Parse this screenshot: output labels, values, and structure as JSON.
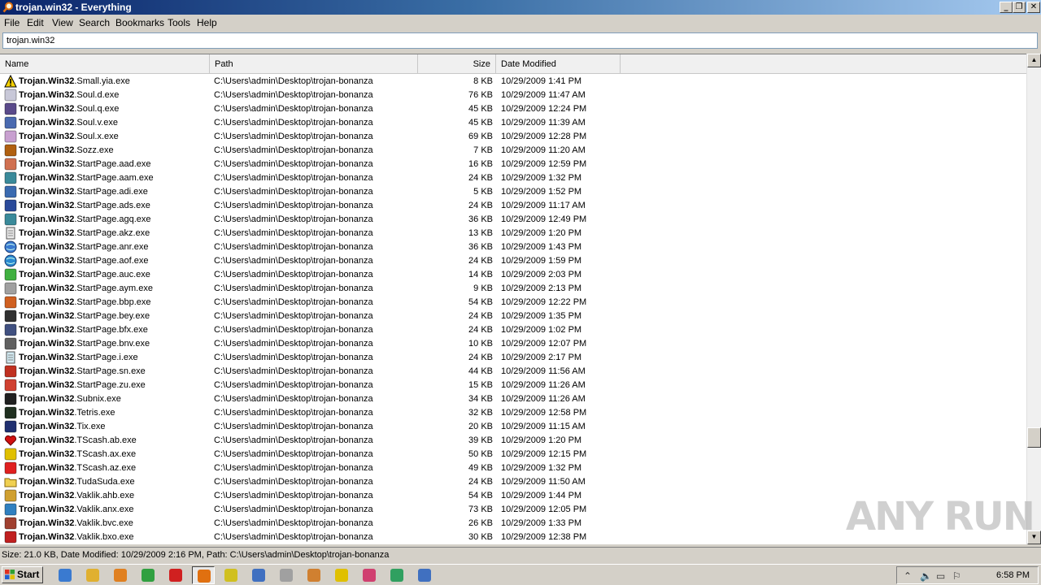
{
  "window": {
    "title": "trojan.win32 - Everything",
    "controls": {
      "minimize": "_",
      "restore": "❐",
      "close": "✕"
    }
  },
  "menu": [
    "File",
    "Edit",
    "View",
    "Search",
    "Bookmarks",
    "Tools",
    "Help"
  ],
  "search": {
    "value": "trojan.win32"
  },
  "columns": {
    "name": "Name",
    "path": "Path",
    "size": "Size",
    "date": "Date Modified"
  },
  "rows": [
    {
      "bold": "Trojan.Win32",
      "rest": ".Small.yia.exe",
      "path": "C:\\Users\\admin\\Desktop\\trojan-bonanza",
      "size": "8 KB",
      "date": "10/29/2009 1:41 PM",
      "icon": "warning-icon",
      "color": "#f4d000"
    },
    {
      "bold": "Trojan.Win32",
      "rest": ".Soul.d.exe",
      "path": "C:\\Users\\admin\\Desktop\\trojan-bonanza",
      "size": "76 KB",
      "date": "10/29/2009 11:47 AM",
      "icon": "generic-app-icon",
      "color": "#c8c8d8"
    },
    {
      "bold": "Trojan.Win32",
      "rest": ".Soul.q.exe",
      "path": "C:\\Users\\admin\\Desktop\\trojan-bonanza",
      "size": "45 KB",
      "date": "10/29/2009 12:24 PM",
      "icon": "character-icon",
      "color": "#5a4a8a"
    },
    {
      "bold": "Trojan.Win32",
      "rest": ".Soul.v.exe",
      "path": "C:\\Users\\admin\\Desktop\\trojan-bonanza",
      "size": "45 KB",
      "date": "10/29/2009 11:39 AM",
      "icon": "window-icon",
      "color": "#4a6ab0"
    },
    {
      "bold": "Trojan.Win32",
      "rest": ".Soul.x.exe",
      "path": "C:\\Users\\admin\\Desktop\\trojan-bonanza",
      "size": "69 KB",
      "date": "10/29/2009 12:28 PM",
      "icon": "generic-app-icon",
      "color": "#c8a0d0"
    },
    {
      "bold": "Trojan.Win32",
      "rest": ".Sozz.exe",
      "path": "C:\\Users\\admin\\Desktop\\trojan-bonanza",
      "size": "7 KB",
      "date": "10/29/2009 11:20 AM",
      "icon": "emblem-icon",
      "color": "#b06010"
    },
    {
      "bold": "Trojan.Win32",
      "rest": ".StartPage.aad.exe",
      "path": "C:\\Users\\admin\\Desktop\\trojan-bonanza",
      "size": "16 KB",
      "date": "10/29/2009 12:59 PM",
      "icon": "photo-icon",
      "color": "#d07050"
    },
    {
      "bold": "Trojan.Win32",
      "rest": ".StartPage.aam.exe",
      "path": "C:\\Users\\admin\\Desktop\\trojan-bonanza",
      "size": "24 KB",
      "date": "10/29/2009 1:32 PM",
      "icon": "setup-icon",
      "color": "#3a8a9a"
    },
    {
      "bold": "Trojan.Win32",
      "rest": ".StartPage.adi.exe",
      "path": "C:\\Users\\admin\\Desktop\\trojan-bonanza",
      "size": "5 KB",
      "date": "10/29/2009 1:52 PM",
      "icon": "setup-icon",
      "color": "#3a6ab0"
    },
    {
      "bold": "Trojan.Win32",
      "rest": ".StartPage.ads.exe",
      "path": "C:\\Users\\admin\\Desktop\\trojan-bonanza",
      "size": "24 KB",
      "date": "10/29/2009 11:17 AM",
      "icon": "setup-icon",
      "color": "#2a4a9a"
    },
    {
      "bold": "Trojan.Win32",
      "rest": ".StartPage.agq.exe",
      "path": "C:\\Users\\admin\\Desktop\\trojan-bonanza",
      "size": "36 KB",
      "date": "10/29/2009 12:49 PM",
      "icon": "setup-icon",
      "color": "#3a8a9a"
    },
    {
      "bold": "Trojan.Win32",
      "rest": ".StartPage.akz.exe",
      "path": "C:\\Users\\admin\\Desktop\\trojan-bonanza",
      "size": "13 KB",
      "date": "10/29/2009 1:20 PM",
      "icon": "document-icon",
      "color": "#e8e8e8"
    },
    {
      "bold": "Trojan.Win32",
      "rest": ".StartPage.anr.exe",
      "path": "C:\\Users\\admin\\Desktop\\trojan-bonanza",
      "size": "36 KB",
      "date": "10/29/2009 1:43 PM",
      "icon": "globe-icon",
      "color": "#3a7ad0"
    },
    {
      "bold": "Trojan.Win32",
      "rest": ".StartPage.aof.exe",
      "path": "C:\\Users\\admin\\Desktop\\trojan-bonanza",
      "size": "24 KB",
      "date": "10/29/2009 1:59 PM",
      "icon": "globe-icon",
      "color": "#2a8ad0"
    },
    {
      "bold": "Trojan.Win32",
      "rest": ".StartPage.auc.exe",
      "path": "C:\\Users\\admin\\Desktop\\trojan-bonanza",
      "size": "14 KB",
      "date": "10/29/2009 2:03 PM",
      "icon": "recycle-icon",
      "color": "#40b040"
    },
    {
      "bold": "Trojan.Win32",
      "rest": ".StartPage.aym.exe",
      "path": "C:\\Users\\admin\\Desktop\\trojan-bonanza",
      "size": "9 KB",
      "date": "10/29/2009 2:13 PM",
      "icon": "window-icon",
      "color": "#a0a0a0"
    },
    {
      "bold": "Trojan.Win32",
      "rest": ".StartPage.bbp.exe",
      "path": "C:\\Users\\admin\\Desktop\\trojan-bonanza",
      "size": "54 KB",
      "date": "10/29/2009 12:22 PM",
      "icon": "java-icon",
      "color": "#d06020"
    },
    {
      "bold": "Trojan.Win32",
      "rest": ".StartPage.bey.exe",
      "path": "C:\\Users\\admin\\Desktop\\trojan-bonanza",
      "size": "24 KB",
      "date": "10/29/2009 1:35 PM",
      "icon": "floppy-icon",
      "color": "#303030"
    },
    {
      "bold": "Trojan.Win32",
      "rest": ".StartPage.bfx.exe",
      "path": "C:\\Users\\admin\\Desktop\\trojan-bonanza",
      "size": "24 KB",
      "date": "10/29/2009 1:02 PM",
      "icon": "computer-icon",
      "color": "#405080"
    },
    {
      "bold": "Trojan.Win32",
      "rest": ".StartPage.bnv.exe",
      "path": "C:\\Users\\admin\\Desktop\\trojan-bonanza",
      "size": "10 KB",
      "date": "10/29/2009 12:07 PM",
      "icon": "disk-icon",
      "color": "#606060"
    },
    {
      "bold": "Trojan.Win32",
      "rest": ".StartPage.i.exe",
      "path": "C:\\Users\\admin\\Desktop\\trojan-bonanza",
      "size": "24 KB",
      "date": "10/29/2009 2:17 PM",
      "icon": "document-icon",
      "color": "#d0e8f0"
    },
    {
      "bold": "Trojan.Win32",
      "rest": ".StartPage.sn.exe",
      "path": "C:\\Users\\admin\\Desktop\\trojan-bonanza",
      "size": "44 KB",
      "date": "10/29/2009 11:56 AM",
      "icon": "character-icon",
      "color": "#c03020"
    },
    {
      "bold": "Trojan.Win32",
      "rest": ".StartPage.zu.exe",
      "path": "C:\\Users\\admin\\Desktop\\trojan-bonanza",
      "size": "15 KB",
      "date": "10/29/2009 11:26 AM",
      "icon": "character-icon",
      "color": "#d04030"
    },
    {
      "bold": "Trojan.Win32",
      "rest": ".Subnix.exe",
      "path": "C:\\Users\\admin\\Desktop\\trojan-bonanza",
      "size": "34 KB",
      "date": "10/29/2009 11:26 AM",
      "icon": "monitor-icon",
      "color": "#202020"
    },
    {
      "bold": "Trojan.Win32",
      "rest": ".Tetris.exe",
      "path": "C:\\Users\\admin\\Desktop\\trojan-bonanza",
      "size": "32 KB",
      "date": "10/29/2009 12:58 PM",
      "icon": "game-icon",
      "color": "#203020"
    },
    {
      "bold": "Trojan.Win32",
      "rest": ".Tix.exe",
      "path": "C:\\Users\\admin\\Desktop\\trojan-bonanza",
      "size": "20 KB",
      "date": "10/29/2009 11:15 AM",
      "icon": "grid-icon",
      "color": "#203070"
    },
    {
      "bold": "Trojan.Win32",
      "rest": ".TScash.ab.exe",
      "path": "C:\\Users\\admin\\Desktop\\trojan-bonanza",
      "size": "39 KB",
      "date": "10/29/2009 1:20 PM",
      "icon": "heart-icon",
      "color": "#d01010"
    },
    {
      "bold": "Trojan.Win32",
      "rest": ".TScash.ax.exe",
      "path": "C:\\Users\\admin\\Desktop\\trojan-bonanza",
      "size": "50 KB",
      "date": "10/29/2009 12:15 PM",
      "icon": "lightning-icon",
      "color": "#e0c000"
    },
    {
      "bold": "Trojan.Win32",
      "rest": ".TScash.az.exe",
      "path": "C:\\Users\\admin\\Desktop\\trojan-bonanza",
      "size": "49 KB",
      "date": "10/29/2009 1:32 PM",
      "icon": "generic-app-icon",
      "color": "#e02020"
    },
    {
      "bold": "Trojan.Win32",
      "rest": ".TudaSuda.exe",
      "path": "C:\\Users\\admin\\Desktop\\trojan-bonanza",
      "size": "24 KB",
      "date": "10/29/2009 11:50 AM",
      "icon": "folder-icon",
      "color": "#f0d050"
    },
    {
      "bold": "Trojan.Win32",
      "rest": ".Vaklik.ahb.exe",
      "path": "C:\\Users\\admin\\Desktop\\trojan-bonanza",
      "size": "54 KB",
      "date": "10/29/2009 1:44 PM",
      "icon": "bottle-icon",
      "color": "#d0a030"
    },
    {
      "bold": "Trojan.Win32",
      "rest": ".Vaklik.anx.exe",
      "path": "C:\\Users\\admin\\Desktop\\trojan-bonanza",
      "size": "73 KB",
      "date": "10/29/2009 12:05 PM",
      "icon": "users-icon",
      "color": "#3080c0"
    },
    {
      "bold": "Trojan.Win32",
      "rest": ".Vaklik.bvc.exe",
      "path": "C:\\Users\\admin\\Desktop\\trojan-bonanza",
      "size": "26 KB",
      "date": "10/29/2009 1:33 PM",
      "icon": "character-icon",
      "color": "#a04030"
    },
    {
      "bold": "Trojan.Win32",
      "rest": ".Vaklik.bxo.exe",
      "path": "C:\\Users\\admin\\Desktop\\trojan-bonanza",
      "size": "30 KB",
      "date": "10/29/2009 12:38 PM",
      "icon": "bow-icon",
      "color": "#c02020"
    }
  ],
  "status": "Size: 21.0 KB, Date Modified: 10/29/2009 2:16 PM, Path: C:\\Users\\admin\\Desktop\\trojan-bonanza",
  "watermark": "ANY RUN",
  "taskbar": {
    "start_label": "Start",
    "apps": [
      {
        "name": "ie-icon",
        "color": "#3a7ad0"
      },
      {
        "name": "explorer-icon",
        "color": "#e0b030"
      },
      {
        "name": "media-player-icon",
        "color": "#e08020"
      },
      {
        "name": "chrome-icon",
        "color": "#30a040"
      },
      {
        "name": "stop-icon",
        "color": "#d02020"
      },
      {
        "name": "everything-icon",
        "color": "#e07010",
        "active": true
      },
      {
        "name": "smiley-icon",
        "color": "#d0c020"
      },
      {
        "name": "network-icon",
        "color": "#4070c0"
      },
      {
        "name": "hand-icon",
        "color": "#a0a0a0"
      },
      {
        "name": "archive-icon",
        "color": "#d08030"
      },
      {
        "name": "radiation-icon",
        "color": "#e0c000"
      },
      {
        "name": "flower-icon",
        "color": "#d04070"
      },
      {
        "name": "recycle-bin-icon",
        "color": "#30a060"
      },
      {
        "name": "window-app-icon",
        "color": "#4070c0"
      }
    ],
    "clock": "6:58 PM"
  }
}
